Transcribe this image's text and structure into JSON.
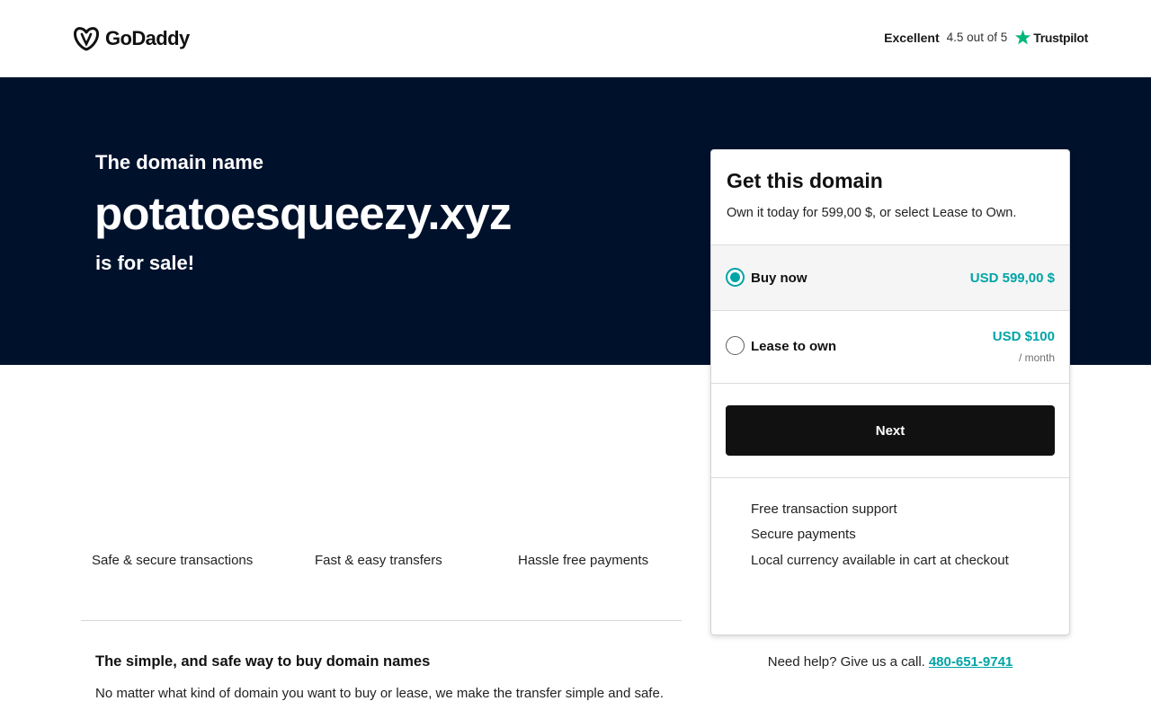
{
  "header": {
    "logo_text": "GoDaddy",
    "trustpilot": {
      "rating_word": "Excellent",
      "score_text": "4.5 out of 5",
      "brand": "Trustpilot"
    }
  },
  "hero": {
    "pre_text": "The domain name",
    "domain": "potatoesqueezy.xyz",
    "post_text": "is for sale!"
  },
  "purchase_card": {
    "title": "Get this domain",
    "subtitle": "Own it today for 599,00 $, or select Lease to Own.",
    "options": [
      {
        "label": "Buy now",
        "price": "USD 599,00 $",
        "selected": true
      },
      {
        "label": "Lease to own",
        "price": "USD $100",
        "unit": "/ month",
        "selected": false
      }
    ],
    "next_label": "Next",
    "features": [
      "Free transaction support",
      "Secure payments",
      "Local currency available in cart at checkout"
    ]
  },
  "perks": [
    "Safe & secure transactions",
    "Fast & easy transfers",
    "Hassle free payments"
  ],
  "info": {
    "title": "The simple, and safe way to buy domain names",
    "body": "No matter what kind of domain you want to buy or lease, we make the transfer simple and safe."
  },
  "help": {
    "text": "Need help? Give us a call.",
    "phone": "480-651-9741"
  },
  "colors": {
    "hero_bg": "#00112c",
    "accent": "#00a4a6",
    "button_bg": "#111111",
    "trustpilot_green": "#00b67a"
  }
}
